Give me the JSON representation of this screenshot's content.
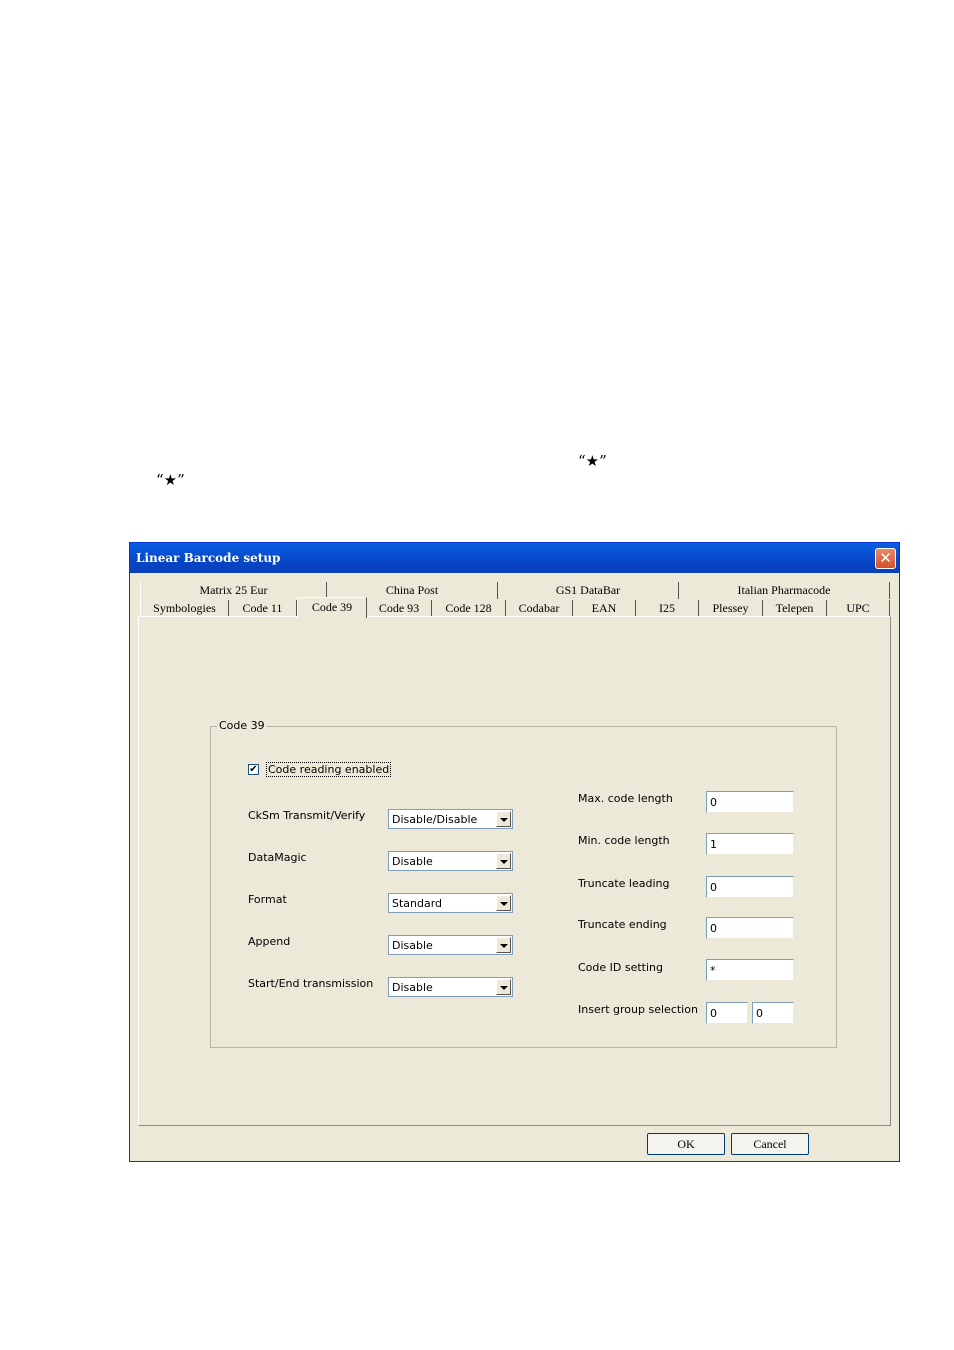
{
  "doc": {
    "star_a": "“★”",
    "star_b": "“★”"
  },
  "window": {
    "title": "Linear Barcode setup",
    "close_glyph": "✕"
  },
  "tabs_top": [
    "Matrix 25 Eur",
    "China Post",
    "GS1 DataBar",
    "Italian Pharmacode"
  ],
  "tabs_bottom": [
    "Symbologies",
    "Code 11",
    "Code 39",
    "Code 93",
    "Code 128",
    "Codabar",
    "EAN",
    "I25",
    "Plessey",
    "Telepen",
    "UPC"
  ],
  "active_tab": "Code 39",
  "group": {
    "title": "Code 39",
    "enable_label": "Code reading enabled",
    "enabled": true,
    "left": [
      {
        "label": "CkSm Transmit/Verify",
        "value": "Disable/Disable"
      },
      {
        "label": "DataMagic",
        "value": "Disable"
      },
      {
        "label": "Format",
        "value": "Standard"
      },
      {
        "label": "Append",
        "value": "Disable"
      },
      {
        "label": "Start/End transmission",
        "value": "Disable"
      }
    ],
    "right": [
      {
        "label": "Max. code length",
        "value": "0"
      },
      {
        "label": "Min. code length",
        "value": "1"
      },
      {
        "label": "Truncate leading",
        "value": "0"
      },
      {
        "label": "Truncate ending",
        "value": "0"
      },
      {
        "label": "Code ID setting",
        "value": "*"
      },
      {
        "label": "Insert group selection",
        "value": "0",
        "value2": "0"
      }
    ]
  },
  "buttons": {
    "ok": "OK",
    "cancel": "Cancel"
  }
}
